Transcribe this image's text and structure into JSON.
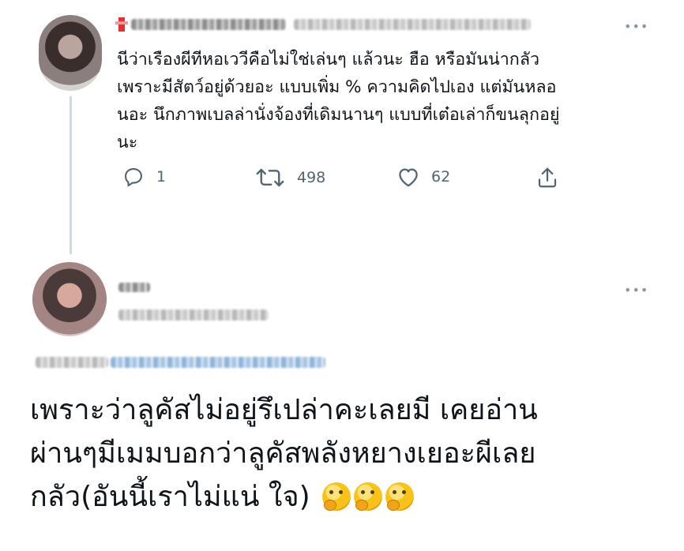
{
  "reply": {
    "text": "นีว่าเรืองผีทีหอเววีคือไม่ใช่เล่นๆ แล้วนะ ฮือ หรือมันน่ากลัว\nเพราะมีสัตว์อยู่ด้วยอะ แบบเพิ่ม % ความคิดไปเอง แต่มันหลอ\nนอะ นึกภาพเบลล่านั่งจ้องที่เดิมนานๆ แบบที่เต๋อเล่าก็ขนลุกอยู่\nนะ",
    "actions": {
      "reply_count": "1",
      "retweet_count": "498",
      "like_count": "62"
    },
    "more_icon": "•••"
  },
  "main_tweet": {
    "text": "เพราะว่าลูคัสไม่อยู่รึเปล่าคะเลยมี เคยอ่าน\nผ่านๆมีเมมบอกว่าลูคัสพลังหยางเยอะผีเลย\nกลัว(อันนี้เราไม่แน่ ใจ)",
    "emojis": [
      "thinking-face",
      "thinking-face",
      "thinking-face"
    ],
    "more_icon": "•••"
  },
  "icons": [
    "reply-icon",
    "retweet-icon",
    "like-icon",
    "share-icon",
    "more-icon"
  ],
  "colors": {
    "text": "#0f1419",
    "muted": "#536471",
    "thread_line": "#cfd9de",
    "marker": "#e2312e"
  }
}
